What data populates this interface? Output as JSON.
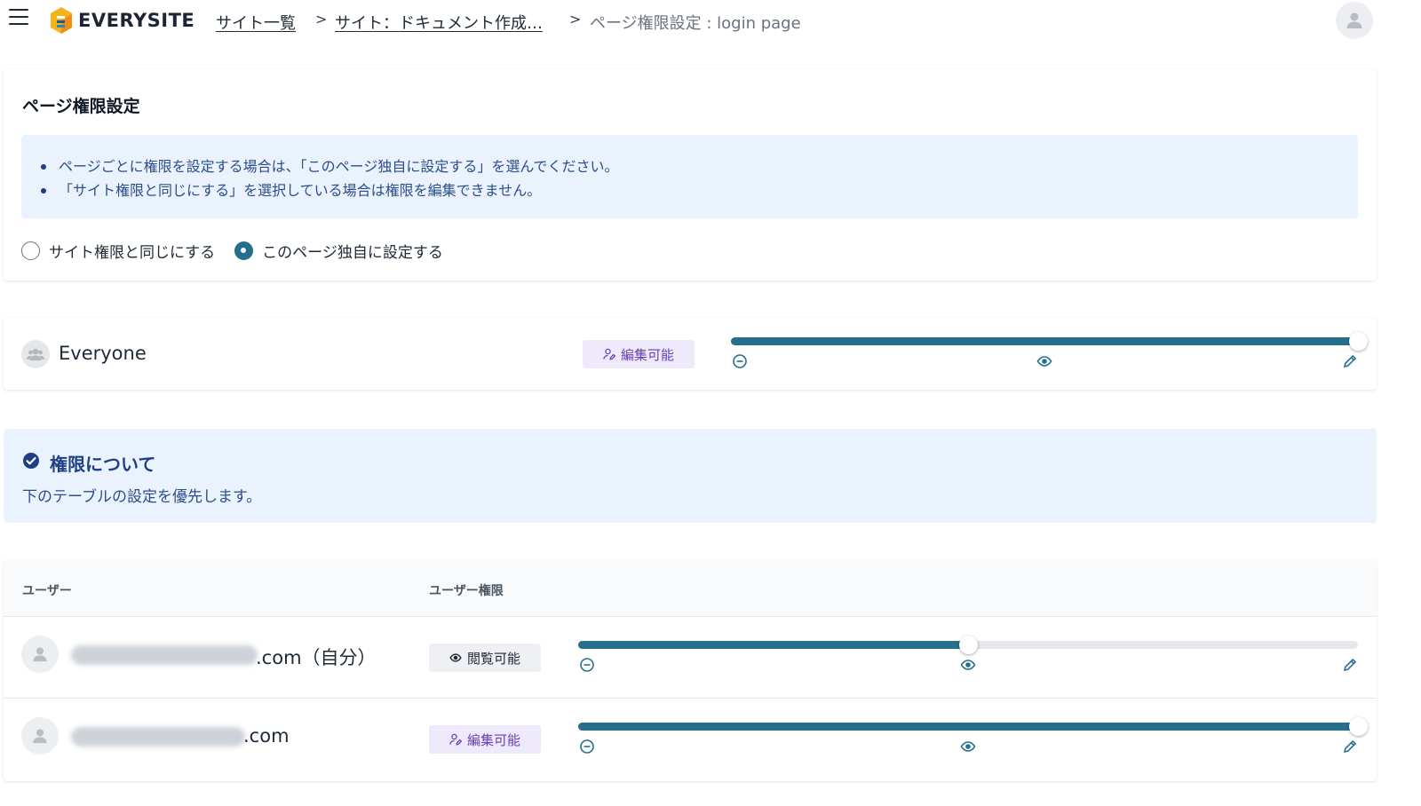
{
  "header": {
    "logo_text": "EVERYSITE",
    "breadcrumbs": [
      "サイト一覧",
      "サイト：ドキュメント作成…",
      "ページ権限設定 : login page"
    ],
    "separator": ">"
  },
  "page_settings": {
    "title": "ページ権限設定",
    "info": [
      "ページごとに権限を設定する場合は、「このページ独自に設定する」を選んでください。",
      "「サイト権限と同じにする」を選択している場合は権限を編集できません。"
    ],
    "radio_options": [
      {
        "label": "サイト権限と同じにする",
        "checked": false
      },
      {
        "label": "このページ独自に設定する",
        "checked": true
      }
    ]
  },
  "everyone": {
    "name": "Everyone",
    "badge": "編集可能",
    "level": 1.0
  },
  "notice": {
    "title": "権限について",
    "text": "下のテーブルの設定を優先します。"
  },
  "table": {
    "headers": [
      "ユーザー",
      "ユーザー権限"
    ],
    "rows": [
      {
        "email_suffix": ".com（自分）",
        "badge": "閲覧可能",
        "badge_icon": "eye-icon",
        "level": 0.5
      },
      {
        "email_suffix": ".com",
        "badge": "編集可能",
        "badge_icon": "user-edit-icon",
        "level": 1.0
      }
    ]
  },
  "colors": {
    "accent": "#266f8c",
    "info_bg": "#e9f2fd",
    "edit_badge_bg": "#eee9fb",
    "edit_badge_text": "#6b3fb6"
  },
  "icons": [
    "menu-icon",
    "user-icon",
    "group-icon",
    "minus-circle-icon",
    "eye-icon",
    "pencil-icon",
    "check-circle-icon",
    "user-edit-icon"
  ]
}
